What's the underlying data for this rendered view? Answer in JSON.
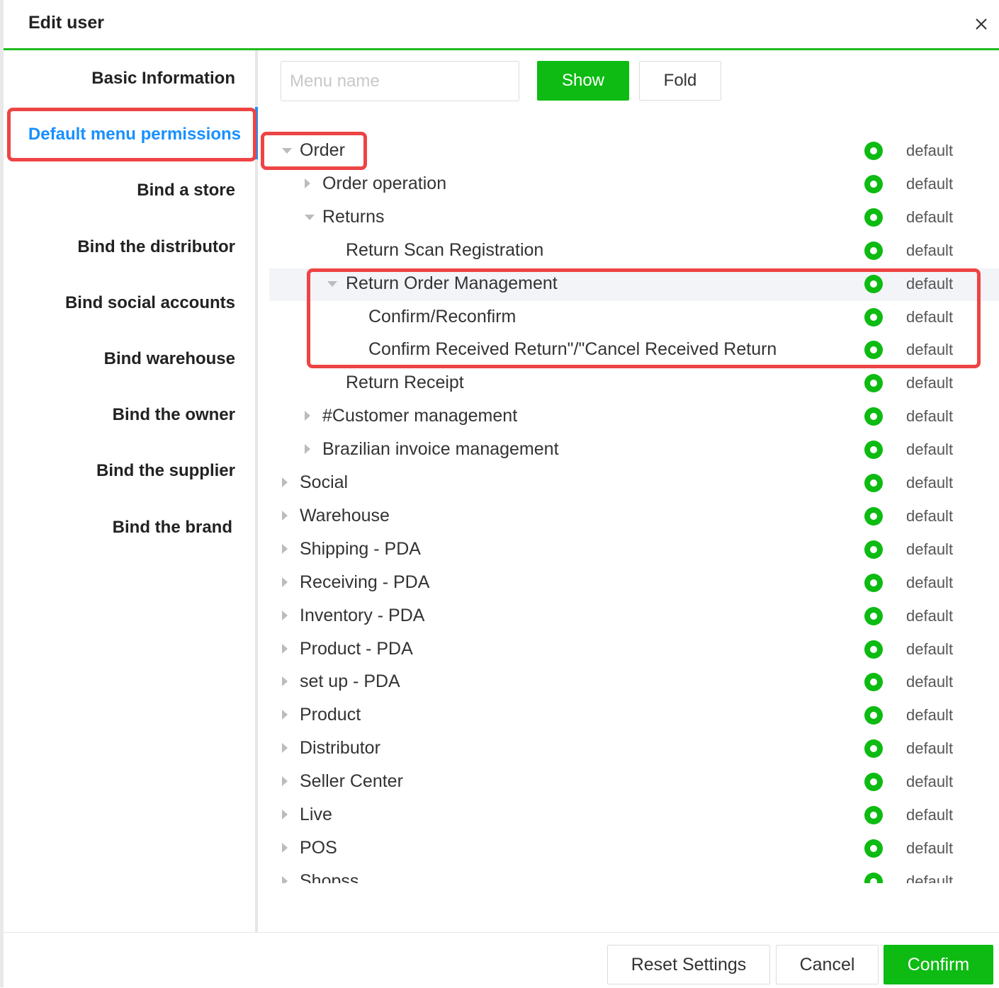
{
  "dialog": {
    "title": "Edit user"
  },
  "sidebar": {
    "items": [
      {
        "label": "Basic Information"
      },
      {
        "label": "Default menu permissions",
        "active": true
      },
      {
        "label": "Bind a store"
      },
      {
        "label": "Bind the distributor"
      },
      {
        "label": "Bind social accounts"
      },
      {
        "label": "Bind warehouse"
      },
      {
        "label": "Bind the owner"
      },
      {
        "label": "Bind the supplier"
      },
      {
        "label": "Bind the brand"
      }
    ]
  },
  "toolbar": {
    "search_placeholder": "Menu name",
    "search_value": "",
    "show_label": "Show",
    "fold_label": "Fold"
  },
  "tree": {
    "radio_label": "default",
    "nodes": [
      {
        "label": "Order",
        "level": 0,
        "expander": "down"
      },
      {
        "label": "Order operation",
        "level": 1,
        "expander": "right"
      },
      {
        "label": "Returns",
        "level": 1,
        "expander": "down"
      },
      {
        "label": "Return Scan Registration",
        "level": 2,
        "expander": "none"
      },
      {
        "label": "Return Order Management",
        "level": 2,
        "expander": "down",
        "highlighted": true
      },
      {
        "label": "Confirm/Reconfirm",
        "level": 3,
        "expander": "none"
      },
      {
        "label": "Confirm Received Return\"/\"Cancel Received Return",
        "level": 3,
        "expander": "none"
      },
      {
        "label": "Return Receipt",
        "level": 2,
        "expander": "none"
      },
      {
        "label": "#Customer management",
        "level": 1,
        "expander": "right"
      },
      {
        "label": "Brazilian invoice management",
        "level": 1,
        "expander": "right"
      },
      {
        "label": "Social",
        "level": 0,
        "expander": "right"
      },
      {
        "label": "Warehouse",
        "level": 0,
        "expander": "right"
      },
      {
        "label": "Shipping - PDA",
        "level": 0,
        "expander": "right"
      },
      {
        "label": "Receiving - PDA",
        "level": 0,
        "expander": "right"
      },
      {
        "label": "Inventory - PDA",
        "level": 0,
        "expander": "right"
      },
      {
        "label": "Product - PDA",
        "level": 0,
        "expander": "right"
      },
      {
        "label": "set up - PDA",
        "level": 0,
        "expander": "right"
      },
      {
        "label": "Product",
        "level": 0,
        "expander": "right"
      },
      {
        "label": "Distributor",
        "level": 0,
        "expander": "right"
      },
      {
        "label": "Seller Center",
        "level": 0,
        "expander": "right"
      },
      {
        "label": "Live",
        "level": 0,
        "expander": "right"
      },
      {
        "label": "POS",
        "level": 0,
        "expander": "right"
      },
      {
        "label": "Shopss",
        "level": 0,
        "expander": "right"
      }
    ]
  },
  "footer": {
    "reset_label": "Reset Settings",
    "cancel_label": "Cancel",
    "confirm_label": "Confirm"
  },
  "colors": {
    "accent_green": "#0dbb12",
    "active_blue": "#1890ff",
    "annotation_red": "#ee4444"
  }
}
